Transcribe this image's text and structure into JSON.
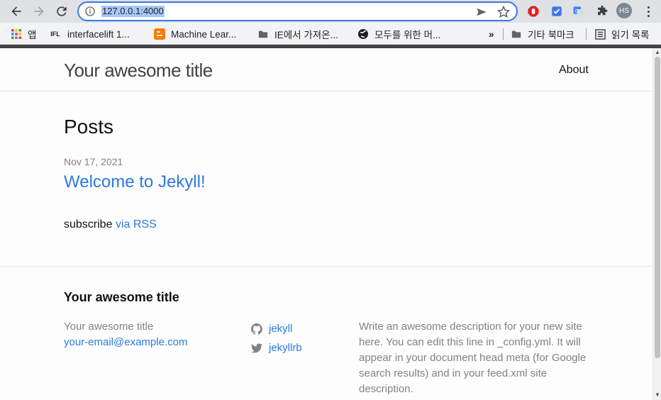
{
  "browser": {
    "url": "127.0.0.1:4000",
    "avatar_initials": "HS",
    "bookmarks": [
      {
        "label": "앱",
        "icon": "apps-grid-icon"
      },
      {
        "label": "interfacelift 1...",
        "icon": "ifl-icon"
      },
      {
        "label": "Machine Lear...",
        "icon": "blogger-icon"
      },
      {
        "label": "IE에서 가져온...",
        "icon": "folder-icon"
      },
      {
        "label": "모두를 위한 머...",
        "icon": "globe-icon"
      }
    ],
    "overflow_label": "»",
    "other_bookmarks": "기타 북마크",
    "reading_list": "읽기 목록"
  },
  "site": {
    "title": "Your awesome title",
    "nav_about": "About"
  },
  "main": {
    "heading": "Posts",
    "posts": [
      {
        "date": "Nov 17, 2021",
        "title": "Welcome to Jekyll!"
      }
    ],
    "subscribe_text": "subscribe",
    "subscribe_link": "via RSS"
  },
  "footer": {
    "heading": "Your awesome title",
    "name": "Your awesome title",
    "email": "your-email@example.com",
    "social": [
      {
        "icon": "github-icon",
        "label": "jekyll"
      },
      {
        "icon": "twitter-icon",
        "label": "jekyllrb"
      }
    ],
    "description": "Write an awesome description for your new site here. You can edit this line in _config.yml. It will appear in your document head meta (for Google search results) and in your feed.xml site description."
  },
  "colors": {
    "link": "#2a7ae2",
    "muted": "#828282",
    "text": "#111111",
    "omnibox_border": "#3b78e7"
  }
}
